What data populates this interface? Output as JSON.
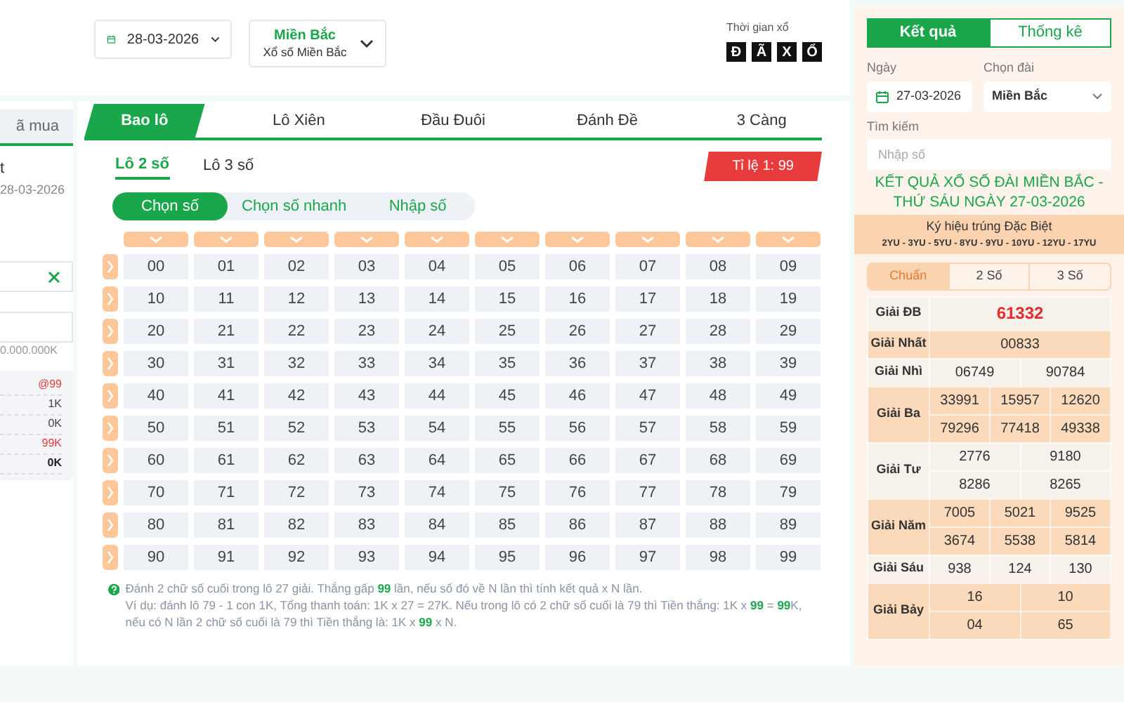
{
  "toolbar": {
    "date": "28-03-2026",
    "region": {
      "name": "Miền Bắc",
      "subtitle": "Xổ số Miền Bắc"
    },
    "countdown": {
      "label": "Thời gian xổ",
      "tiles": [
        "Đ",
        "Ã",
        "X",
        "Ổ"
      ]
    }
  },
  "left_panel": {
    "tab": "ã mua",
    "heading": "t",
    "date": "28-03-2026",
    "amount": "0.000.000K",
    "summary": [
      {
        "value": "@99",
        "kind": "odds"
      },
      {
        "value": "1K",
        "kind": "plain"
      },
      {
        "value": "0K",
        "kind": "plain"
      },
      {
        "value": "99K",
        "kind": "win"
      },
      {
        "value": "0K",
        "kind": "total"
      }
    ]
  },
  "main": {
    "tabs": [
      {
        "label": "Bao lô",
        "selected": true
      },
      {
        "label": "Lô Xiên",
        "selected": false
      },
      {
        "label": "Đầu Đuôi",
        "selected": false
      },
      {
        "label": "Đánh Đề",
        "selected": false
      },
      {
        "label": "3 Càng",
        "selected": false
      }
    ],
    "subtabs": [
      {
        "label": "Lô 2 số",
        "selected": true
      },
      {
        "label": "Lô 3 số",
        "selected": false
      }
    ],
    "rate": "Tỉ lệ 1: 99",
    "modes": [
      {
        "label": "Chọn số",
        "selected": true
      },
      {
        "label": "Chọn số nhanh",
        "selected": false
      },
      {
        "label": "Nhập số",
        "selected": false
      }
    ],
    "grid": [
      [
        "00",
        "01",
        "02",
        "03",
        "04",
        "05",
        "06",
        "07",
        "08",
        "09"
      ],
      [
        "10",
        "11",
        "12",
        "13",
        "14",
        "15",
        "16",
        "17",
        "18",
        "19"
      ],
      [
        "20",
        "21",
        "22",
        "23",
        "24",
        "25",
        "26",
        "27",
        "28",
        "29"
      ],
      [
        "30",
        "31",
        "32",
        "33",
        "34",
        "35",
        "36",
        "37",
        "38",
        "39"
      ],
      [
        "40",
        "41",
        "42",
        "43",
        "44",
        "45",
        "46",
        "47",
        "48",
        "49"
      ],
      [
        "50",
        "51",
        "52",
        "53",
        "54",
        "55",
        "56",
        "57",
        "58",
        "59"
      ],
      [
        "60",
        "61",
        "62",
        "63",
        "64",
        "65",
        "66",
        "67",
        "68",
        "69"
      ],
      [
        "70",
        "71",
        "72",
        "73",
        "74",
        "75",
        "76",
        "77",
        "78",
        "79"
      ],
      [
        "80",
        "81",
        "82",
        "83",
        "84",
        "85",
        "86",
        "87",
        "88",
        "89"
      ],
      [
        "90",
        "91",
        "92",
        "93",
        "94",
        "95",
        "96",
        "97",
        "98",
        "99"
      ]
    ],
    "notes": [
      "Đánh 2 chữ số cuối trong lô 27 giải. Thắng gấp **99** lần, nếu số đó về N lần thì tính kết quả x N lần.",
      "Ví dụ: đánh lô 79 - 1 con 1K, Tổng thanh toán: 1K x 27 = 27K. Nếu trong lô có 2 chữ số cuối là 79 thì Tiền thắng: 1K x **99** = **99**K, nếu có N lần 2 chữ số cuối là 79 thì Tiền thắng là: 1K x **99** x N."
    ]
  },
  "results": {
    "tabs": [
      {
        "label": "Kết quả",
        "selected": true
      },
      {
        "label": "Thống kê",
        "selected": false
      }
    ],
    "date_label": "Ngày",
    "date": "27-03-2026",
    "station_label": "Chọn đài",
    "station": "Miền Bắc",
    "search_label": "Tìm kiếm",
    "search_placeholder": "Nhập số",
    "title": "KẾT QUẢ XỔ SỐ ĐÀI MIỀN BẮC - THỨ SÁU NGÀY 27-03-2026",
    "special_label": "Ký hiệu trúng Đặc Biệt",
    "special_codes": "2YU - 3YU - 5YU - 8YU - 9YU - 10YU - 12YU - 17YU",
    "modes": [
      {
        "label": "Chuẩn",
        "selected": true
      },
      {
        "label": "2 Số",
        "selected": false
      },
      {
        "label": "3 Số",
        "selected": false
      }
    ],
    "prizes": [
      {
        "name": "Giải ĐB",
        "kind": "special",
        "rows": [
          [
            "61332"
          ]
        ]
      },
      {
        "name": "Giải Nhất",
        "kind": "normal",
        "rows": [
          [
            "00833"
          ]
        ]
      },
      {
        "name": "Giải Nhì",
        "kind": "normal",
        "rows": [
          [
            "06749",
            "90784"
          ]
        ]
      },
      {
        "name": "Giải Ba",
        "kind": "normal",
        "rows": [
          [
            "33991",
            "15957",
            "12620"
          ],
          [
            "79296",
            "77418",
            "49338"
          ]
        ]
      },
      {
        "name": "Giải Tư",
        "kind": "normal",
        "rows": [
          [
            "2776",
            "9180"
          ],
          [
            "8286",
            "8265"
          ]
        ]
      },
      {
        "name": "Giải Năm",
        "kind": "normal",
        "rows": [
          [
            "7005",
            "5021",
            "9525"
          ],
          [
            "3674",
            "5538",
            "5814"
          ]
        ]
      },
      {
        "name": "Giải Sáu",
        "kind": "normal",
        "rows": [
          [
            "938",
            "124",
            "130"
          ]
        ]
      },
      {
        "name": "Giải Bảy",
        "kind": "normal",
        "rows": [
          [
            "16",
            "10"
          ],
          [
            "04",
            "65"
          ]
        ]
      }
    ]
  }
}
